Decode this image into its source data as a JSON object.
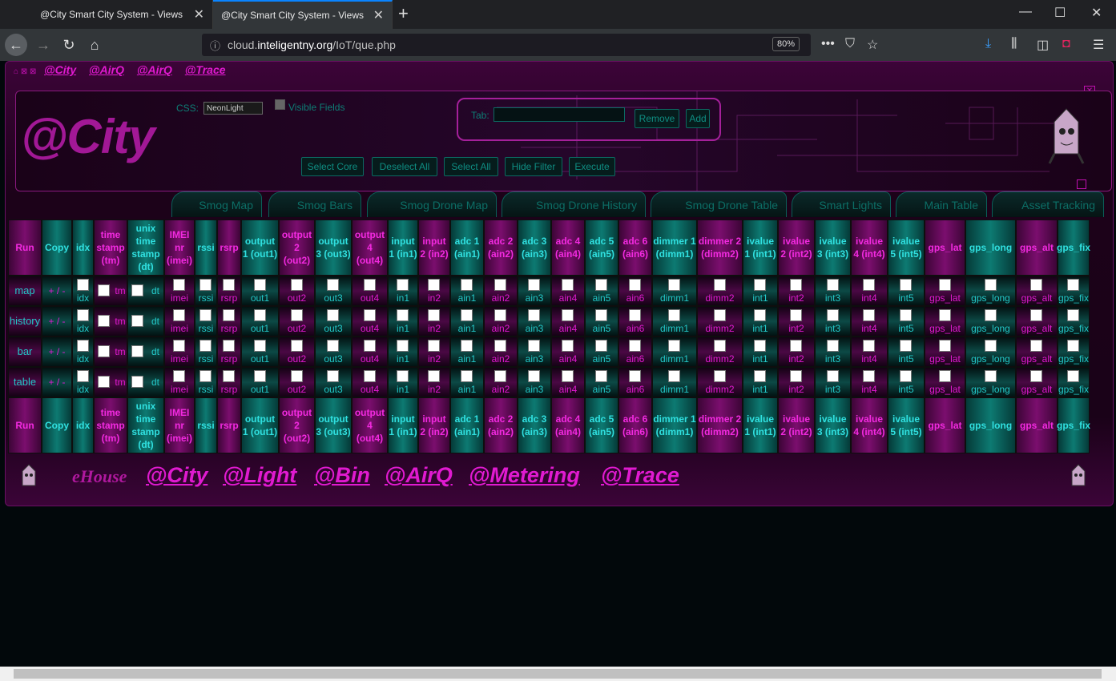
{
  "browser": {
    "tabs": [
      {
        "title": "@City Smart City System - Views"
      },
      {
        "title": "@City Smart City System - Views"
      }
    ],
    "url_prefix": "cloud.",
    "url_domain": "inteligentny.org",
    "url_path": "/IoT/que.php",
    "zoom": "80%"
  },
  "top_links": [
    "@City",
    "@AirQ",
    "@AirQ",
    "@Trace"
  ],
  "header": {
    "logo": "@City",
    "css_label": "CSS:",
    "css_value": "NeonLight",
    "visible_fields_label": "Visible Fields",
    "tab_label": "Tab:",
    "remove_label": "Remove",
    "add_label": "Add",
    "buttons": [
      "Select Core",
      "Deselect All",
      "Select All",
      "Hide Filter",
      "Execute"
    ]
  },
  "nav_tabs": [
    "Smog Map",
    "Smog Bars",
    "Smog Drone Map",
    "Smog Drone History",
    "Smog Drone Table",
    "Smart Lights",
    "Main Table",
    "Asset Tracking"
  ],
  "columns": [
    {
      "h": "Run",
      "c": "m"
    },
    {
      "h": "Copy",
      "c": "c"
    },
    {
      "h": "idx",
      "c": "c",
      "s": "idx"
    },
    {
      "h": "time stamp (tm)",
      "c": "m",
      "s": "tm"
    },
    {
      "h": "unix time stamp (dt)",
      "c": "c",
      "s": "dt"
    },
    {
      "h": "IMEI nr (imei)",
      "c": "m",
      "s": "imei"
    },
    {
      "h": "rssi",
      "c": "c",
      "s": "rssi"
    },
    {
      "h": "rsrp",
      "c": "m",
      "s": "rsrp"
    },
    {
      "h": "output 1 (out1)",
      "c": "c",
      "s": "out1"
    },
    {
      "h": "output 2 (out2)",
      "c": "m",
      "s": "out2"
    },
    {
      "h": "output 3 (out3)",
      "c": "c",
      "s": "out3"
    },
    {
      "h": "output 4 (out4)",
      "c": "m",
      "s": "out4"
    },
    {
      "h": "input 1 (in1)",
      "c": "c",
      "s": "in1"
    },
    {
      "h": "input 2 (in2)",
      "c": "m",
      "s": "in2"
    },
    {
      "h": "adc 1 (ain1)",
      "c": "c",
      "s": "ain1"
    },
    {
      "h": "adc 2 (ain2)",
      "c": "m",
      "s": "ain2"
    },
    {
      "h": "adc 3 (ain3)",
      "c": "c",
      "s": "ain3"
    },
    {
      "h": "adc 4 (ain4)",
      "c": "m",
      "s": "ain4"
    },
    {
      "h": "adc 5 (ain5)",
      "c": "c",
      "s": "ain5"
    },
    {
      "h": "adc 6 (ain6)",
      "c": "m",
      "s": "ain6"
    },
    {
      "h": "dimmer 1 (dimm1)",
      "c": "c",
      "s": "dimm1"
    },
    {
      "h": "dimmer 2 (dimm2)",
      "c": "m",
      "s": "dimm2"
    },
    {
      "h": "ivalue 1 (int1)",
      "c": "c",
      "s": "int1"
    },
    {
      "h": "ivalue 2 (int2)",
      "c": "m",
      "s": "int2"
    },
    {
      "h": "ivalue 3 (int3)",
      "c": "c",
      "s": "int3"
    },
    {
      "h": "ivalue 4 (int4)",
      "c": "m",
      "s": "int4"
    },
    {
      "h": "ivalue 5 (int5)",
      "c": "c",
      "s": "int5"
    },
    {
      "h": "gps_lat",
      "c": "m",
      "s": "gps_lat"
    },
    {
      "h": "gps_long",
      "c": "c",
      "s": "gps_long"
    },
    {
      "h": "gps_alt",
      "c": "m",
      "s": "gps_alt"
    },
    {
      "h": "gps_fix",
      "c": "c",
      "s": "gps_fix"
    }
  ],
  "rows": [
    "map",
    "history",
    "bar",
    "table"
  ],
  "copy_label": "+ / -",
  "footer_links": [
    "@City",
    "@Light",
    "@Bin",
    "@AirQ",
    "@Metering",
    "@Trace"
  ],
  "footer_ehouse": "eHouse"
}
